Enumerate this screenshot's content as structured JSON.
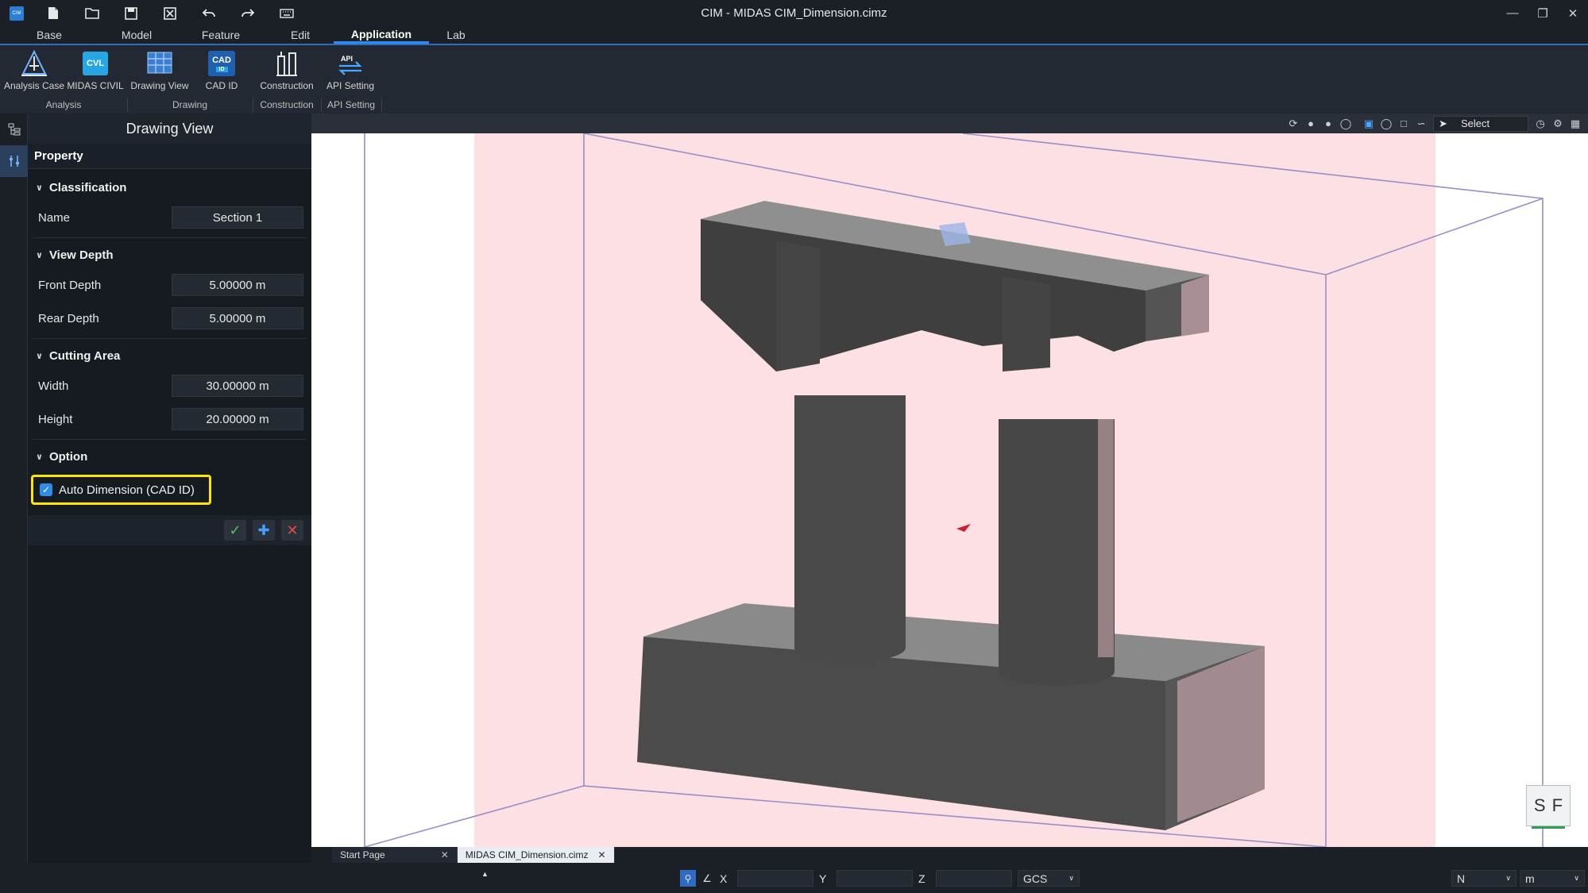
{
  "window": {
    "title": "CIM - MIDAS CIM_Dimension.cimz",
    "logo_text": "CIM"
  },
  "quick_access": [
    "new-file-icon",
    "open-folder-icon",
    "save-icon",
    "close-file-icon",
    "undo-icon",
    "redo-icon",
    "keyboard-icon"
  ],
  "menu": {
    "tabs": [
      {
        "label": "Base",
        "active": false
      },
      {
        "label": "Model",
        "active": false
      },
      {
        "label": "Feature",
        "active": false
      },
      {
        "label": "Edit",
        "active": false
      },
      {
        "label": "Application",
        "active": true
      },
      {
        "label": "Lab",
        "active": false
      }
    ]
  },
  "ribbon": {
    "buttons": [
      {
        "label": "Analysis Case",
        "icon": "analysis-case-icon"
      },
      {
        "label": "MIDAS CIVIL",
        "icon": "midas-civil-icon",
        "badge": "CVL"
      },
      {
        "label": "Drawing View",
        "icon": "drawing-view-icon"
      },
      {
        "label": "CAD ID",
        "icon": "cad-id-icon",
        "badge": "CAD",
        "sub_badge": "ID"
      },
      {
        "label": "Construction",
        "icon": "construction-icon"
      },
      {
        "label": "API Setting",
        "icon": "api-setting-icon",
        "badge": "API"
      }
    ],
    "groups": [
      "Analysis",
      "Drawing",
      "Construction",
      "API Setting"
    ]
  },
  "panel": {
    "title": "Drawing View",
    "tab": "Property",
    "sections": {
      "classification": {
        "title": "Classification",
        "name_label": "Name",
        "name_value": "Section 1"
      },
      "view_depth": {
        "title": "View Depth",
        "front_label": "Front Depth",
        "front_value": "5.00000 m",
        "rear_label": "Rear Depth",
        "rear_value": "5.00000 m"
      },
      "cutting_area": {
        "title": "Cutting Area",
        "width_label": "Width",
        "width_value": "30.00000 m",
        "height_label": "Height",
        "height_value": "20.00000 m"
      },
      "option": {
        "title": "Option",
        "auto_dimension_label": "Auto Dimension (CAD ID)",
        "auto_dimension_checked": true
      }
    }
  },
  "viewport": {
    "select_label": "Select",
    "view_cube": {
      "left": "S",
      "right": "F"
    }
  },
  "doc_tabs": [
    {
      "label": "Start Page",
      "active": false
    },
    {
      "label": "MIDAS CIM_Dimension.cimz",
      "active": true
    }
  ],
  "status": {
    "x_label": "X",
    "y_label": "Y",
    "z_label": "Z",
    "coord_system": "GCS",
    "force_unit": "N",
    "length_unit": "m"
  },
  "colors": {
    "accent": "#2d8cf0",
    "highlight": "#ffe600",
    "section_plane": "#fde0e3",
    "concrete": "#4b4b4b"
  }
}
